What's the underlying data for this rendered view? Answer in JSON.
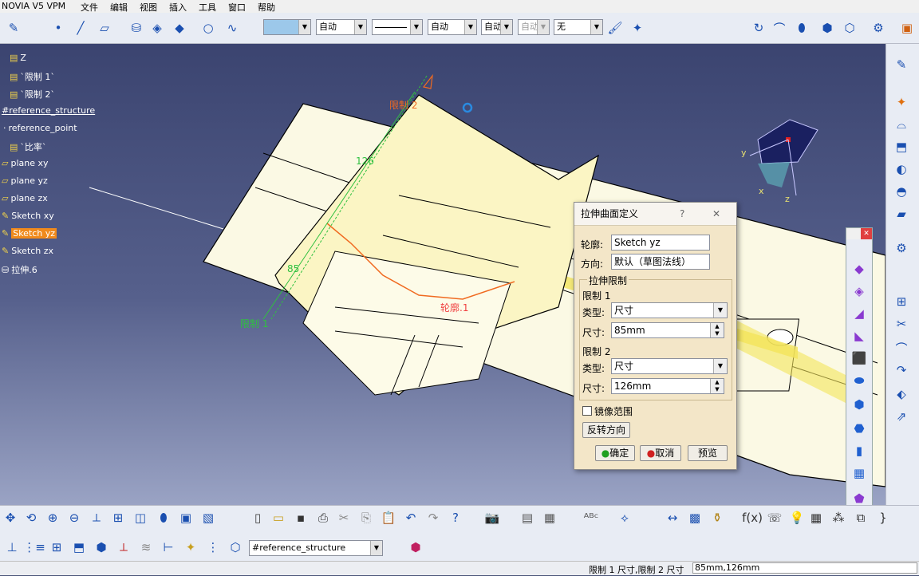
{
  "app": {
    "title": "NOVIA V5 VPM"
  },
  "menu": [
    "文件",
    "编辑",
    "视图",
    "插入",
    "工具",
    "窗口",
    "帮助"
  ],
  "toolbar": {
    "color_combo": "",
    "linetype1": "自动",
    "line_style": "",
    "linetype2": "自动",
    "combo_a": "自动",
    "combo_b": "自动",
    "combo_c": "无"
  },
  "tree": [
    {
      "label": "Z"
    },
    {
      "label": "`限制 1`"
    },
    {
      "label": "`限制 2`"
    },
    {
      "label": "#reference_structure"
    },
    {
      "label": "reference_point"
    },
    {
      "label": "`比率`"
    },
    {
      "label": "plane xy"
    },
    {
      "label": "plane yz"
    },
    {
      "label": "plane zx"
    },
    {
      "label": "Sketch xy"
    },
    {
      "label": "Sketch yz"
    },
    {
      "label": "Sketch zx"
    },
    {
      "label": "拉伸.6"
    }
  ],
  "viewport_labels": {
    "limit2": "限制 2",
    "limit1": "限制 1",
    "dim_top": "126",
    "dim_left": "85",
    "profile": "轮廓.1",
    "axis_y": "y",
    "axis_x": "x",
    "axis_z": "z"
  },
  "dialog": {
    "title": "拉伸曲面定义",
    "help": "?",
    "close": "✕",
    "profile_label": "轮廓:",
    "profile_value": "Sketch yz",
    "direction_label": "方向:",
    "direction_value": "默认（草图法线）",
    "group_label": "拉伸限制",
    "limit1_label": "限制 1",
    "type_label": "类型:",
    "limit1_type": "尺寸",
    "size_label": "尺寸:",
    "limit1_size": "85mm",
    "limit2_label": "限制 2",
    "limit2_type": "尺寸",
    "limit2_size": "126mm",
    "mirror_label": "镜像范围",
    "reverse_button": "反转方向",
    "ok_button": "确定",
    "cancel_button": "取消",
    "preview_button": "预览"
  },
  "bottom": {
    "reference_combo": "#reference_structure"
  },
  "status": {
    "text": "限制 1 尺寸,限制 2 尺寸",
    "value": "85mm,126mm"
  },
  "colors": {
    "viewport_top": "#3b4470",
    "part_fill": "#fbf9e4",
    "extrude_fill": "#fbf5c4",
    "highlight": "#f08a1c",
    "dialog_bg": "#f3e6c8"
  }
}
